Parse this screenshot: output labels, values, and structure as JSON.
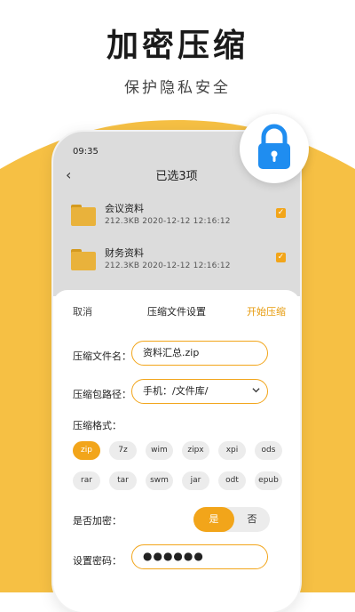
{
  "colors": {
    "accent": "#f2a51a",
    "wave": "#f6c044",
    "lock": "#1f8df0"
  },
  "headline": "加密压缩",
  "subline": "保护隐私安全",
  "icons": {
    "lock": "lock-icon",
    "back": "back-arrow-icon",
    "folder": "folder-icon",
    "check": "checkbox-checked-icon"
  },
  "status_bar": {
    "time": "09:35"
  },
  "topbar": {
    "back": "‹",
    "title": "已选3项"
  },
  "files": [
    {
      "name": "会议资料",
      "meta": "212.3KB   2020-12-12   12:16:12",
      "checked": true
    },
    {
      "name": "财务资料",
      "meta": "212.3KB   2020-12-12   12:16:12",
      "checked": true
    }
  ],
  "sheet": {
    "cancel": "取消",
    "title": "压缩文件设置",
    "start": "开始压缩",
    "filename_label": "压缩文件名：",
    "filename_value": "资料汇总.zip",
    "path_label": "压缩包路径：",
    "path_value": "手机：/文件库/",
    "format_label": "压缩格式：",
    "formats": [
      "zip",
      "7z",
      "wim",
      "zipx",
      "xpi",
      "ods",
      "rar",
      "tar",
      "swm",
      "jar",
      "odt",
      "epub"
    ],
    "selected_format": "zip",
    "encrypt_label": "是否加密：",
    "encrypt_yes": "是",
    "encrypt_no": "否",
    "encrypt_selected": "是",
    "password_label": "设置密码：",
    "password_value": "●●●●●●"
  }
}
